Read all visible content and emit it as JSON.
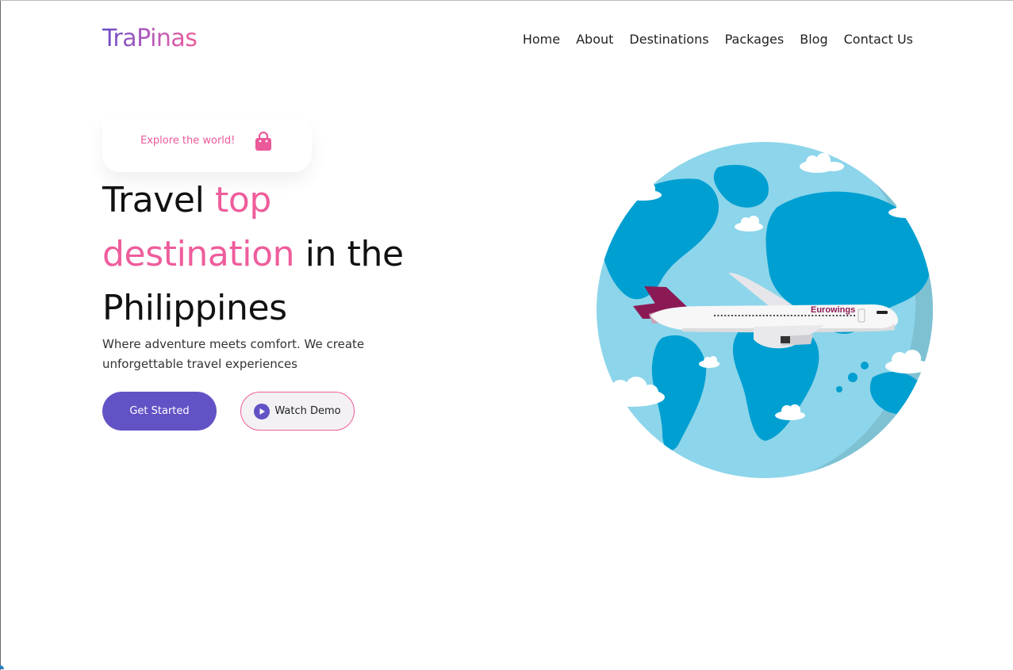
{
  "brand": {
    "logo_text": "TraPinas"
  },
  "nav": {
    "items": [
      {
        "label": "Home"
      },
      {
        "label": "About"
      },
      {
        "label": "Destinations"
      },
      {
        "label": "Packages"
      },
      {
        "label": "Blog"
      },
      {
        "label": "Contact Us"
      }
    ]
  },
  "hero": {
    "badge_text": "Explore the world!",
    "badge_icon": "shopping-bag-icon",
    "headline": {
      "part1": "Travel ",
      "part2": "top",
      "part3": "destination",
      "part4": " in the",
      "part5": "Philippines"
    },
    "subtitle": "Where adventure meets comfort. We create unforgettable travel experiences",
    "primary_button": "Get Started",
    "secondary_button": "Watch Demo",
    "airline_livery": "Eurowings"
  },
  "colors": {
    "accent_pink": "#ee5d9c",
    "primary_purple": "#6153c6",
    "ocean_blue": "#009fd1"
  }
}
